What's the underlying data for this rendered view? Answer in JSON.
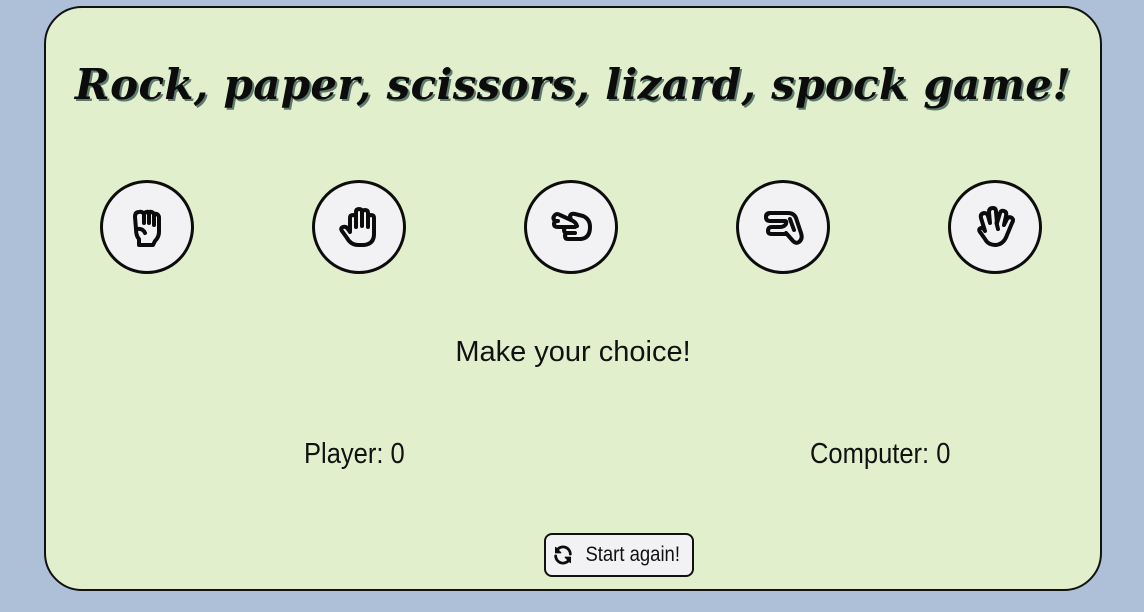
{
  "title": "Rock, paper, scissors, lizard, spock game!",
  "choices": [
    {
      "name": "rock",
      "icon": "hand-back-fist-icon"
    },
    {
      "name": "paper",
      "icon": "hand-paper-icon"
    },
    {
      "name": "scissors",
      "icon": "hand-scissors-icon"
    },
    {
      "name": "lizard",
      "icon": "hand-lizard-icon"
    },
    {
      "name": "spock",
      "icon": "hand-spock-icon"
    }
  ],
  "message": "Make your choice!",
  "scores": {
    "player": "Player: 0",
    "computer": "Computer: 0"
  },
  "restart": {
    "label": "Start again!",
    "icon": "rotate-icon"
  },
  "colors": {
    "page_background": "#aec0d7",
    "card_background": "#e1efcd",
    "button_background": "#f2f2f4",
    "title_shadow": "#5f7a6d",
    "ink": "#0c0c0c"
  }
}
